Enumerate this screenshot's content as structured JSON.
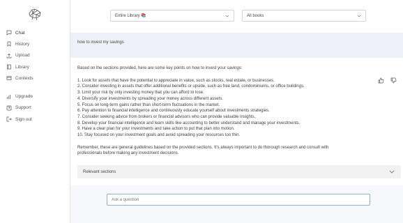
{
  "sidebar": {
    "logo_icon": "brain-icon",
    "items": [
      {
        "label": "Chat",
        "icon": "chat-bubble-icon"
      },
      {
        "label": "History",
        "icon": "bookmark-icon"
      },
      {
        "label": "Upload",
        "icon": "upload-icon"
      },
      {
        "label": "Library",
        "icon": "library-icon"
      },
      {
        "label": "Contexts",
        "icon": "contexts-icon"
      }
    ],
    "secondary_items": [
      {
        "label": "Upgrade",
        "icon": "upgrade-icon"
      },
      {
        "label": "Support",
        "icon": "support-icon"
      },
      {
        "label": "Sign out",
        "icon": "sign-out-icon"
      }
    ]
  },
  "filters": {
    "library_select": "Entire Library 📚",
    "books_select": "All books"
  },
  "question": "how to invest my savings",
  "answer": {
    "intro": "Based on the sections provided, here are some key points on how to invest your savings:",
    "points": [
      "1. Look for assets that have the potential to appreciate in value, such as stocks, real estate, or businesses.",
      "2. Consider investing in assets that offer additional benefits or upside, such as free land, condominiums, or office buildings.",
      "3. Limit your risk by only investing money that you can afford to lose.",
      "4. Diversify your investments by spreading your money across different assets.",
      "5. Focus on long-term gains rather than short-term fluctuations in the market.",
      "6. Pay attention to financial intelligence and continuously educate yourself about investments strategies.",
      "7. Consider seeking advice from brokers or financial advisors who can provide valuable insights.",
      "8. Develop your financial intelligence and learn skills like accounting to better understand and manage your investments.",
      "9. Have a clear plan for your investments and take action to put that plan into motion.",
      "10. Stay focused on your investment goals and avoid spreading your resources too thin."
    ],
    "outro": "Remember, these are general guidelines based on the provided sections. It's always important to do thorough research and consult with professionals before making any investment decisions."
  },
  "relevant_sections_label": "Relevant sections",
  "ask": {
    "placeholder": "Ask a question"
  },
  "colors": {
    "accent": "#8fb3d8",
    "question_band": "#eef1f8"
  }
}
